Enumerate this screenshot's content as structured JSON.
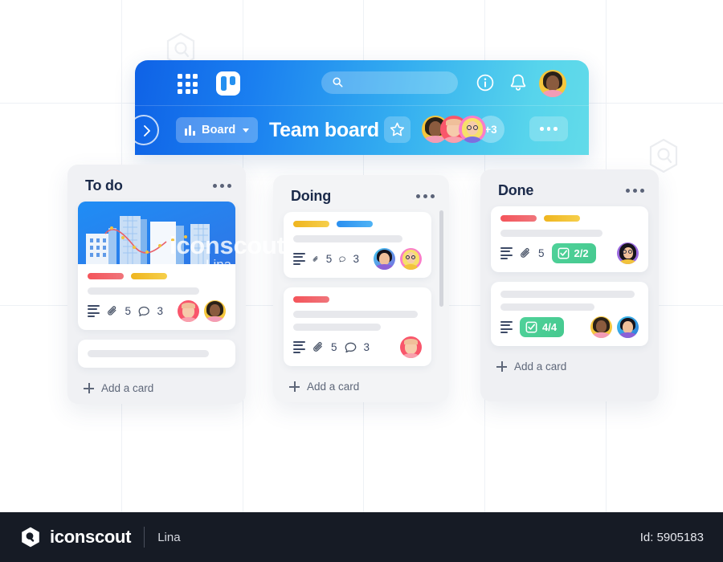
{
  "footer": {
    "brand": "iconscout",
    "author": "Lina",
    "id_label": "Id: 5905183"
  },
  "watermark": {
    "text": "iconscout",
    "sub": "Lina"
  },
  "app": {
    "topbar": {
      "apps_grid_icon": "grid-9-dots-icon",
      "logo_icon": "trello-logo-icon",
      "search_placeholder": "",
      "search_icon": "search-icon",
      "info_icon": "info-circle-icon",
      "bell_icon": "bell-icon",
      "avatar_icon": "user-avatar"
    },
    "subbar": {
      "back_icon": "chevron-right-icon",
      "view_label": "Board",
      "view_icon": "board-bars-icon",
      "caret_icon": "chevron-down-icon",
      "title": "Team board",
      "star_icon": "star-icon",
      "members_overflow": "+3",
      "more_icon": "more-dots-icon"
    }
  },
  "columns": [
    {
      "title": "To do",
      "menu_icon": "more-dots-icon",
      "add_card_label": "Add a card",
      "cards": [
        {
          "has_cover": true,
          "labels": [
            "red",
            "yellow"
          ],
          "skeleton_lines": 1,
          "description_icon": "description-lines-icon",
          "attachment_icon": "paperclip-icon",
          "attachments": "5",
          "comment_icon": "comment-icon",
          "comments": "3",
          "avatars": [
            "red",
            "yellow"
          ]
        },
        {
          "has_cover": false,
          "labels": [],
          "skeleton_lines": 1,
          "avatars": []
        }
      ]
    },
    {
      "title": "Doing",
      "menu_icon": "more-dots-icon",
      "add_card_label": "Add a card",
      "cards": [
        {
          "has_cover": false,
          "labels": [
            "yellow",
            "blue"
          ],
          "skeleton_lines": 1,
          "description_icon": "description-lines-icon",
          "attachment_icon": "paperclip-icon",
          "attachments": "5",
          "comment_icon": "comment-icon",
          "comments": "3",
          "avatars": [
            "blue",
            "pink"
          ]
        },
        {
          "has_cover": false,
          "labels": [
            "red"
          ],
          "skeleton_lines": 2,
          "description_icon": "description-lines-icon",
          "attachment_icon": "paperclip-icon",
          "attachments": "5",
          "comment_icon": "comment-icon",
          "comments": "3",
          "avatars": [
            "red"
          ]
        }
      ]
    },
    {
      "title": "Done",
      "menu_icon": "more-dots-icon",
      "add_card_label": "Add a card",
      "cards": [
        {
          "has_cover": false,
          "labels": [
            "red",
            "yellow"
          ],
          "skeleton_lines": 1,
          "description_icon": "description-lines-icon",
          "attachment_icon": "paperclip-icon",
          "attachments": "5",
          "checklist_icon": "checklist-icon",
          "checklist": "2/2",
          "avatars": [
            "purple"
          ]
        },
        {
          "has_cover": false,
          "labels": [],
          "skeleton_lines": 2,
          "description_icon": "description-lines-icon",
          "checklist_icon": "checklist-icon",
          "checklist": "4/4",
          "avatars": [
            "yellow",
            "blue"
          ]
        }
      ]
    }
  ],
  "colors": {
    "header_gradient_start": "#0f62e6",
    "header_gradient_end": "#62dbe9",
    "label_red": "#f4545a",
    "label_yellow": "#efb51f",
    "label_blue": "#2a8ff0",
    "checklist_green": "#4fd29a",
    "column_bg": "#f0f1f4",
    "footer_bg": "#161b25"
  }
}
